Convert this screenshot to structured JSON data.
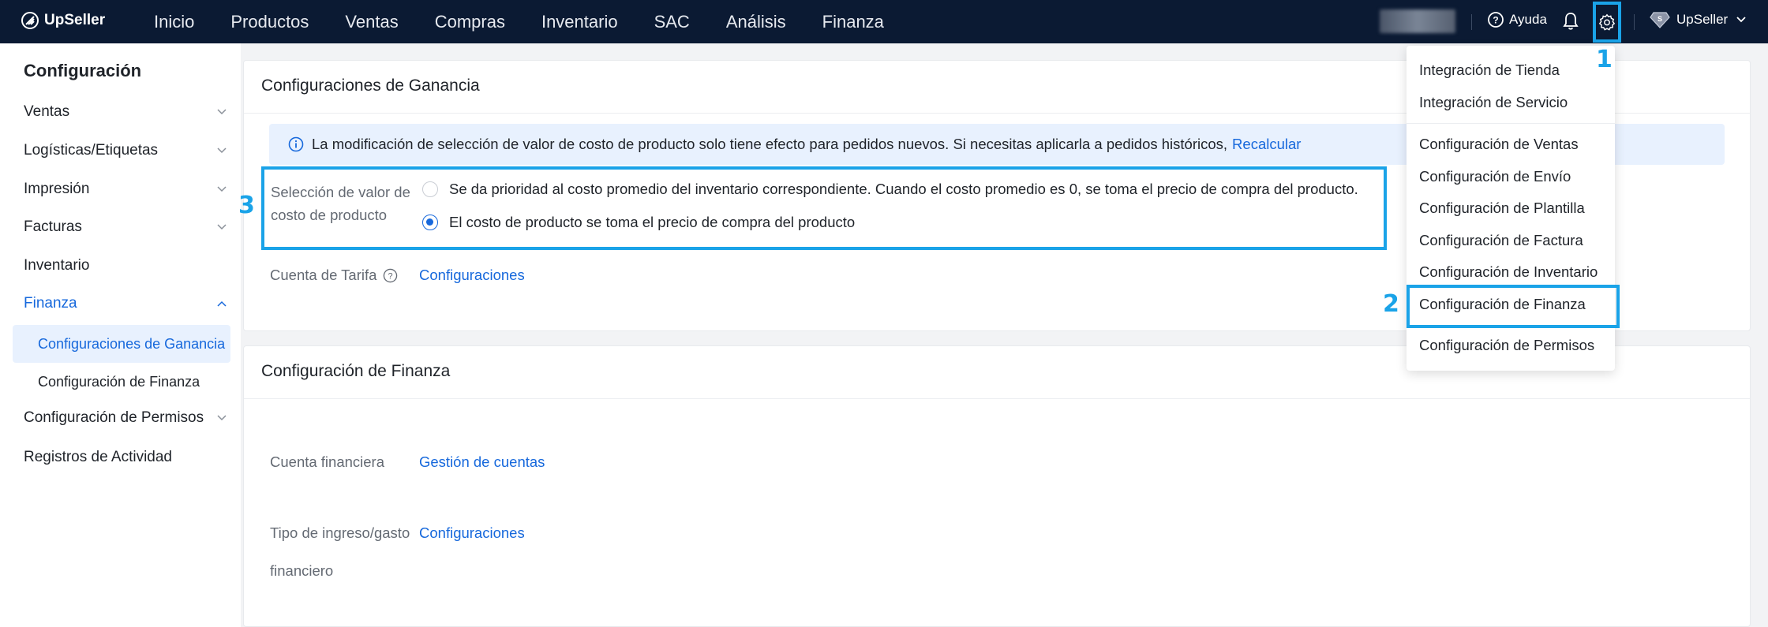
{
  "brand": {
    "name": "UpSeller"
  },
  "nav": {
    "items": [
      "Inicio",
      "Productos",
      "Ventas",
      "Compras",
      "Inventario",
      "SAC",
      "Análisis",
      "Finanza"
    ]
  },
  "topright": {
    "help": "Ayuda",
    "user": "UpSeller"
  },
  "sidebar": {
    "title": "Configuración",
    "items": {
      "ventas": "Ventas",
      "logisticas": "Logísticas/Etiquetas",
      "impresion": "Impresión",
      "facturas": "Facturas",
      "inventario": "Inventario",
      "finanza": "Finanza",
      "sub_ganancia": "Configuraciones de Ganancia",
      "sub_finanza": "Configuración de Finanza",
      "permisos": "Configuración de Permisos",
      "registros": "Registros de Actividad"
    }
  },
  "card1": {
    "title": "Configuraciones de Ganancia",
    "notice": "La modificación de selección de valor de costo de producto solo tiene efecto para pedidos nuevos. Si necesitas aplicarla a pedidos históricos,",
    "notice_link": "Recalcular",
    "cost_label": "Selección de valor de costo de producto",
    "option1": "Se da prioridad al costo promedio del inventario correspondiente. Cuando el costo promedio es 0, se toma el precio de compra del producto.",
    "option2": "El costo de producto se toma el precio de compra del producto",
    "selected_option": 2,
    "tarifa_label": "Cuenta de Tarifa",
    "tarifa_link": "Configuraciones"
  },
  "card2": {
    "title": "Configuración de Finanza",
    "cuenta_label": "Cuenta financiera",
    "cuenta_link": "Gestión de cuentas",
    "tipo_label_1": "Tipo de ingreso/gasto",
    "tipo_label_2": "financiero",
    "tipo_link": "Configuraciones"
  },
  "dropdown": {
    "items": [
      "Integración de Tienda",
      "Integración de Servicio",
      "Configuración de Ventas",
      "Configuración de Envío",
      "Configuración de Plantilla",
      "Configuración de Factura",
      "Configuración de Inventario",
      "Configuración de Finanza",
      "Configuración de Permisos"
    ]
  },
  "annotations": {
    "step1": "1",
    "step2": "2",
    "step3": "3"
  },
  "colors": {
    "topbar": "#0b1a33",
    "accent": "#1668dc",
    "annotation": "#1aa3e8"
  }
}
